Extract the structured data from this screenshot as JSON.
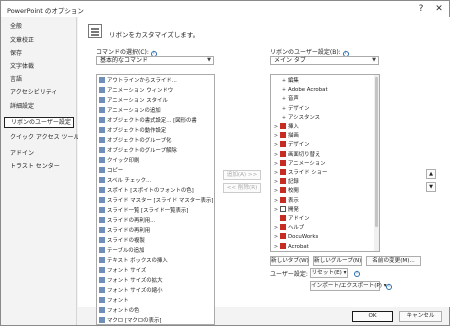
{
  "window": {
    "title": "PowerPoint のオプション",
    "help_glyph": "?",
    "close_glyph": "✕"
  },
  "sidebar": {
    "items": [
      "全般",
      "文章校正",
      "保存",
      "文字体裁",
      "言語",
      "アクセシビリティ",
      "詳細設定",
      "リボンのユーザー設定",
      "クイック アクセス ツール バー",
      "アドイン",
      "トラスト センター"
    ],
    "selected": "リボンのユーザー設定"
  },
  "main": {
    "heading": "リボンをカスタマイズします。",
    "left_label": "コマンドの選択(C):",
    "left_dropdown": "基本的なコマンド",
    "right_label": "リボンのユーザー設定(B):",
    "right_dropdown": "メイン タブ",
    "commands": [
      "アウトラインからスライド...",
      "アニメーション ウィンドウ",
      "アニメーション スタイル",
      "アニメーションの追加",
      "オブジェクトの書式設定... [図形の書",
      "オブジェクトの動作設定",
      "オブジェクトのグループ化",
      "オブジェクトのグループ解除",
      "クイック印刷",
      "コピー",
      "スペル チェック...",
      "スポイト [スポイトのフォントの色]",
      "スライド マスター [スライド マスター表示]",
      "スライド一覧 [スライド一覧表示]",
      "スライドの再利用...",
      "スライドの再利用",
      "スライドの複製",
      "テーブルの追加",
      "テキスト ボックスの挿入",
      "フォント サイズ",
      "フォント サイズの拡大",
      "フォント サイズの縮小",
      "フォント",
      "フォントの色",
      "マクロ [マクロの表示]"
    ],
    "add_button": "追加(A) >>",
    "remove_button": "<< 削除(R)",
    "tabs": [
      {
        "label": "編集",
        "indent": 2,
        "expander": "+"
      },
      {
        "label": "Adobe Acrobat",
        "indent": 2,
        "expander": "+"
      },
      {
        "label": "音声",
        "indent": 2,
        "expander": "+"
      },
      {
        "label": "デザイン",
        "indent": 2,
        "expander": "+"
      },
      {
        "label": "アシスタンス",
        "indent": 2,
        "expander": "+"
      },
      {
        "label": "挿入",
        "indent": 1,
        "expander": ">",
        "checked": true
      },
      {
        "label": "描画",
        "indent": 1,
        "expander": ">",
        "checked": true
      },
      {
        "label": "デザイン",
        "indent": 1,
        "expander": ">",
        "checked": true
      },
      {
        "label": "画面切り替え",
        "indent": 1,
        "expander": ">",
        "checked": true
      },
      {
        "label": "アニメーション",
        "indent": 1,
        "expander": ">",
        "checked": true
      },
      {
        "label": "スライド ショー",
        "indent": 1,
        "expander": ">",
        "checked": true
      },
      {
        "label": "記録",
        "indent": 1,
        "expander": ">",
        "checked": true
      },
      {
        "label": "校閲",
        "indent": 1,
        "expander": ">",
        "checked": true
      },
      {
        "label": "表示",
        "indent": 1,
        "expander": ">",
        "checked": true
      },
      {
        "label": "開発",
        "indent": 1,
        "expander": ">",
        "checked": false
      },
      {
        "label": "アドイン",
        "indent": 1,
        "expander": "",
        "checked": true
      },
      {
        "label": "ヘルプ",
        "indent": 1,
        "expander": ">",
        "checked": true
      },
      {
        "label": "DocuWorks",
        "indent": 1,
        "expander": ">",
        "checked": true
      },
      {
        "label": "Acrobat",
        "indent": 1,
        "expander": ">",
        "checked": true
      }
    ],
    "new_tab_button": "新しいタブ(W)",
    "new_group_button": "新しいグループ(N)",
    "rename_button": "名前の変更(M)...",
    "user_settings_label": "ユーザー設定:",
    "reset_button": "リセット(E) ▾",
    "import_export_button": "インポート/エクスポート(P) ▾"
  },
  "footer": {
    "ok": "OK",
    "cancel": "キャンセル"
  }
}
